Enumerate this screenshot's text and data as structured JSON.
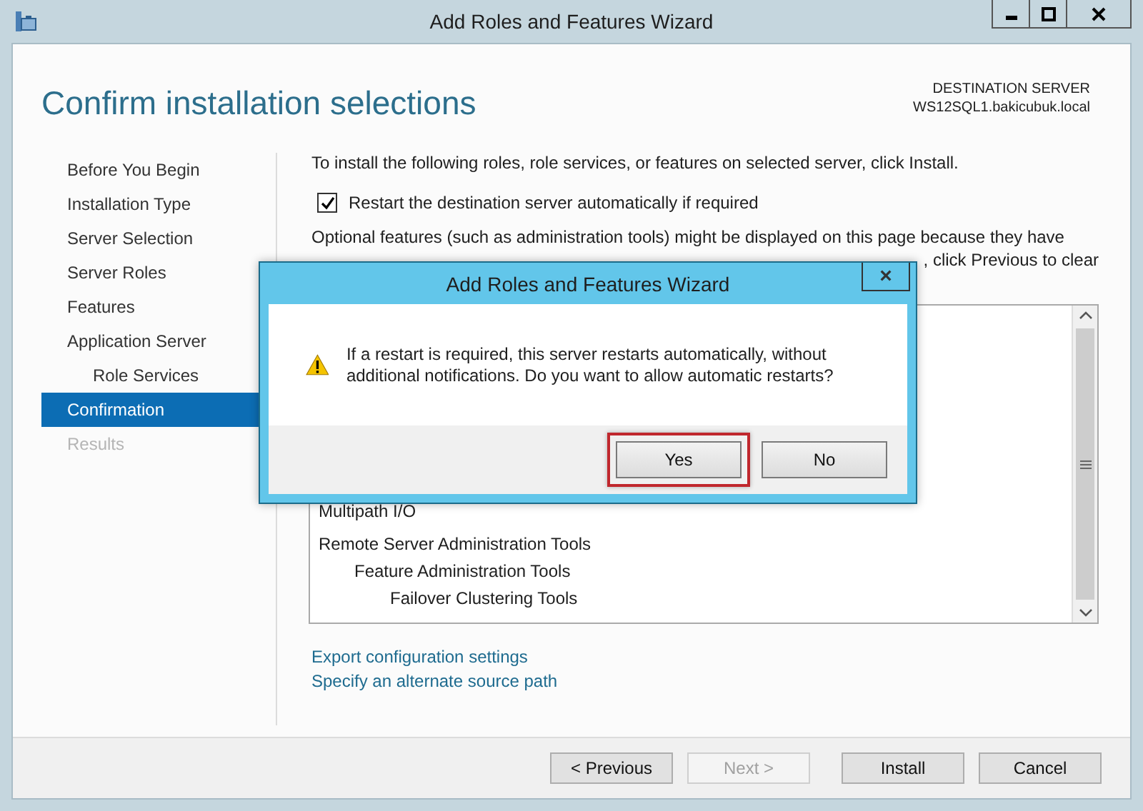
{
  "window": {
    "title": "Add Roles and Features Wizard"
  },
  "header": {
    "title": "Confirm installation selections",
    "destination_label": "DESTINATION SERVER",
    "destination_server": "WS12SQL1.bakicubuk.local"
  },
  "nav": [
    {
      "label": "Before You Begin",
      "selected": false,
      "disabled": false
    },
    {
      "label": "Installation Type",
      "selected": false,
      "disabled": false
    },
    {
      "label": "Server Selection",
      "selected": false,
      "disabled": false
    },
    {
      "label": "Server Roles",
      "selected": false,
      "disabled": false
    },
    {
      "label": "Features",
      "selected": false,
      "disabled": false
    },
    {
      "label": "Application Server",
      "selected": false,
      "disabled": false,
      "children": [
        {
          "label": "Role Services",
          "selected": false,
          "disabled": false
        }
      ]
    },
    {
      "label": "Confirmation",
      "selected": true,
      "disabled": false
    },
    {
      "label": "Results",
      "selected": false,
      "disabled": true
    }
  ],
  "content": {
    "intro": "To install the following roles, role services, or features on selected server, click Install.",
    "restart_checkbox": {
      "label": "Restart the destination server automatically if required",
      "checked": true
    },
    "note_line": "Optional features (such as administration tools) might be displayed on this page because they have",
    "note_fragment": ", click Previous to clear",
    "features": [
      {
        "label": "Multipath I/O"
      },
      {
        "label": "Remote Server Administration Tools",
        "children": [
          {
            "label": "Feature Administration Tools",
            "children": [
              {
                "label": "Failover Clustering Tools"
              }
            ]
          }
        ]
      }
    ],
    "links": [
      "Export configuration settings",
      "Specify an alternate source path"
    ]
  },
  "buttons": [
    {
      "label": "< Previous",
      "disabled": false
    },
    {
      "label": "Next >",
      "disabled": true
    },
    {
      "label": "Install",
      "disabled": false
    },
    {
      "label": "Cancel",
      "disabled": false
    }
  ],
  "dialog": {
    "title": "Add Roles and Features Wizard",
    "close": "×",
    "message": "If a restart is required, this server restarts automatically, without additional notifications. Do you want to allow automatic restarts?",
    "buttons": [
      {
        "label": "Yes",
        "highlighted": true
      },
      {
        "label": "No",
        "highlighted": false
      }
    ]
  }
}
